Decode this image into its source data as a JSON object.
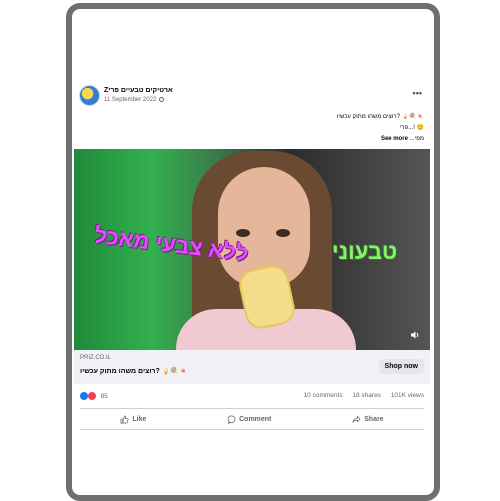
{
  "post": {
    "page_name": "Zארטיקים טבעיים פרי",
    "date": "11 September 2022",
    "text_line1": "רוצים משהו מתוק עכשיו? 🍦🍭🍬",
    "text_line2": "פרי...! 🙂",
    "text_line3": "מפי... See more",
    "see_more": "See more"
  },
  "video": {
    "overlay_left": "ללא צבעי מאכל",
    "overlay_right": "טבעוני"
  },
  "link": {
    "domain": "PRIZ.CO.IL",
    "title": "רוצים משהו מתוק עכשיו? 🍦🍭🍬",
    "shop_label": "Shop now"
  },
  "stats": {
    "reaction_count": "85",
    "comments": "10 comments",
    "shares": "18 shares",
    "views": "101K views"
  },
  "actions": {
    "like": "Like",
    "comment": "Comment",
    "share": "Share"
  },
  "colors": {
    "like_blue": "#1877f2",
    "love_red": "#f33e58",
    "overlay_pink": "#e44cff",
    "overlay_green": "#8cf06a"
  }
}
